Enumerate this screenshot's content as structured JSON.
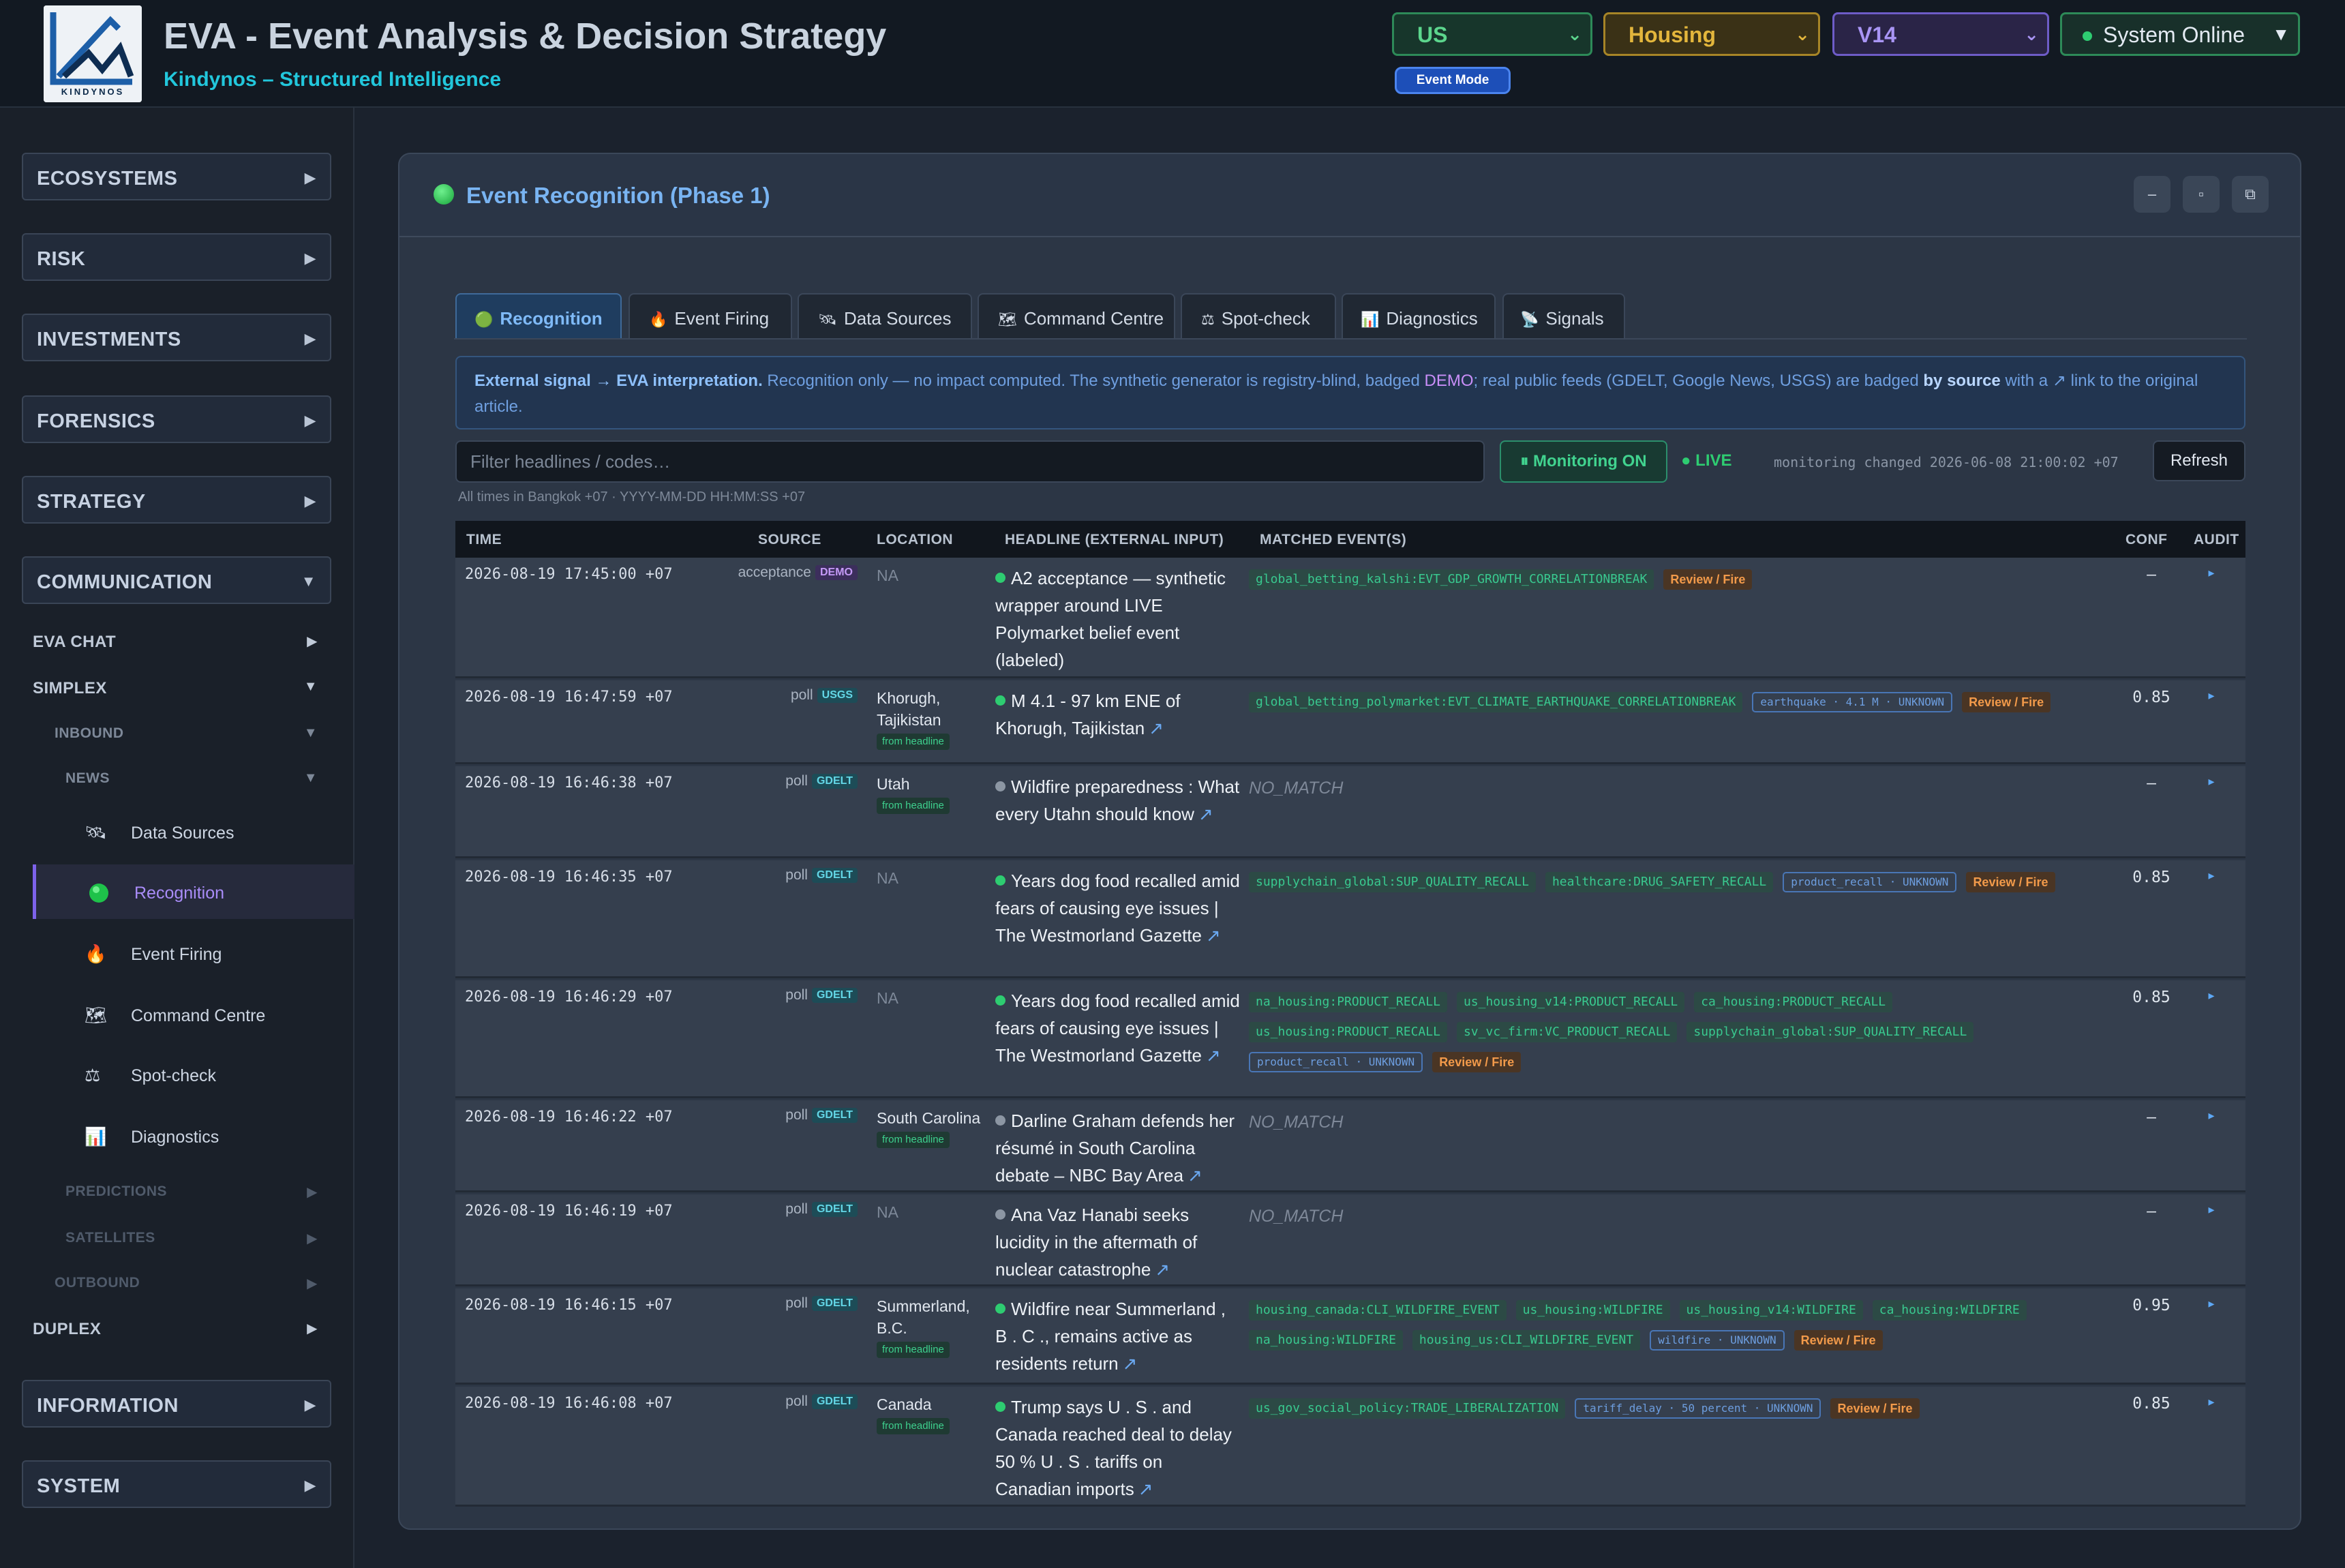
{
  "header": {
    "logo_text": "KINDYNOS",
    "title": "EVA - Event Analysis & Decision Strategy",
    "subtitle": "Kindynos – Structured Intelligence",
    "region": "US",
    "sector": "Housing",
    "version": "V14",
    "status": "System Online",
    "event_mode": "Event Mode"
  },
  "sidebar": {
    "ecosystems": "ECOSYSTEMS",
    "risk": "RISK",
    "investments": "INVESTMENTS",
    "forensics": "FORENSICS",
    "strategy": "STRATEGY",
    "communication": "COMMUNICATION",
    "eva_chat": "EVA CHAT",
    "simplex": "SIMPLEX",
    "inbound": "INBOUND",
    "news": "NEWS",
    "items": [
      {
        "label": "Data Sources",
        "icon": "satellite-icon"
      },
      {
        "label": "Recognition",
        "icon": "green-dot-icon"
      },
      {
        "label": "Event Firing",
        "icon": "fire-icon"
      },
      {
        "label": "Command Centre",
        "icon": "map-icon"
      },
      {
        "label": "Spot-check",
        "icon": "balance-icon"
      },
      {
        "label": "Diagnostics",
        "icon": "chart-icon"
      }
    ],
    "predictions": "PREDICTIONS",
    "satellites": "SATELLITES",
    "outbound": "OUTBOUND",
    "duplex": "DUPLEX",
    "information": "INFORMATION",
    "system": "SYSTEM"
  },
  "panel": {
    "title": "Event Recognition (Phase 1)",
    "tabs": [
      {
        "label": "Recognition",
        "icon": "green-dot-icon"
      },
      {
        "label": "Event Firing",
        "icon": "fire-icon"
      },
      {
        "label": "Data Sources",
        "icon": "satellite-icon"
      },
      {
        "label": "Command Centre",
        "icon": "map-icon"
      },
      {
        "label": "Spot-check",
        "icon": "balance-icon"
      },
      {
        "label": "Diagnostics",
        "icon": "chart-icon"
      },
      {
        "label": "Signals",
        "icon": "antenna-icon"
      }
    ],
    "info": {
      "lead": "External signal → EVA interpretation.",
      "part1": " Recognition only — no impact computed. The synthetic generator is registry-blind, badged ",
      "demo": "DEMO",
      "part2": "; real public feeds (GDELT, Google News, USGS) are badged ",
      "by_source": "by source",
      "part3": " with a ↗ link to the original article."
    },
    "filter_placeholder": "Filter headlines / codes…",
    "monitoring": "⏸ Monitoring ON",
    "live": "● LIVE",
    "monitoring_changed": "monitoring changed 2026-06-08 21:00:02 +07",
    "refresh": "Refresh",
    "tz_note": "All times in Bangkok +07 · YYYY-MM-DD HH:MM:SS +07",
    "columns": {
      "time": "TIME",
      "source": "SOURCE",
      "location": "LOCATION",
      "headline": "HEADLINE (EXTERNAL INPUT)",
      "matched": "MATCHED EVENT(S)",
      "conf": "CONF",
      "audit": "AUDIT"
    }
  },
  "rows": [
    {
      "time": "2026-08-19 17:45:00 +07",
      "source": "acceptance",
      "badge": "DEMO",
      "location": "NA",
      "from_headline": "",
      "headline": "A2 acceptance — synthetic wrapper around LIVE Polymarket belief event (labeled)",
      "dot": "green",
      "link": false,
      "matches": [
        "global_betting_kalshi:EVT_GDP_GROWTH_CORRELATIONBREAK"
      ],
      "hints": [],
      "review": "Review / Fire",
      "no_match": "",
      "conf": "—",
      "audit": "▸"
    },
    {
      "time": "2026-08-19 16:47:59 +07",
      "source": "poll",
      "badge": "USGS",
      "location": "Khorugh, Tajikistan",
      "from_headline": "from headline",
      "headline": "M 4.1 - 97 km ENE of Khorugh, Tajikistan",
      "dot": "green",
      "link": true,
      "matches": [
        "global_betting_polymarket:EVT_CLIMATE_EARTHQUAKE_CORRELATIONBREAK"
      ],
      "hints": [
        "earthquake · 4.1 M · UNKNOWN"
      ],
      "review": "Review / Fire",
      "no_match": "",
      "conf": "0.85",
      "audit": "▸"
    },
    {
      "time": "2026-08-19 16:46:38 +07",
      "source": "poll",
      "badge": "GDELT",
      "location": "Utah",
      "from_headline": "from headline",
      "headline": "Wildfire preparedness : What every Utahn should know",
      "dot": "grey",
      "link": true,
      "matches": [],
      "hints": [],
      "review": "",
      "no_match": "NO_MATCH",
      "conf": "—",
      "audit": "▸"
    },
    {
      "time": "2026-08-19 16:46:35 +07",
      "source": "poll",
      "badge": "GDELT",
      "location": "NA",
      "from_headline": "",
      "headline": "Years dog food recalled amid fears of causing eye issues | The Westmorland Gazette",
      "dot": "green",
      "link": true,
      "matches": [
        "supplychain_global:SUP_QUALITY_RECALL",
        "healthcare:DRUG_SAFETY_RECALL"
      ],
      "hints": [
        "product_recall · UNKNOWN"
      ],
      "review": "Review / Fire",
      "no_match": "",
      "conf": "0.85",
      "audit": "▸"
    },
    {
      "time": "2026-08-19 16:46:29 +07",
      "source": "poll",
      "badge": "GDELT",
      "location": "NA",
      "from_headline": "",
      "headline": "Years dog food recalled amid fears of causing eye issues | The Westmorland Gazette",
      "dot": "green",
      "link": true,
      "matches": [
        "na_housing:PRODUCT_RECALL",
        "us_housing_v14:PRODUCT_RECALL",
        "ca_housing:PRODUCT_RECALL",
        "us_housing:PRODUCT_RECALL",
        "sv_vc_firm:VC_PRODUCT_RECALL",
        "supplychain_global:SUP_QUALITY_RECALL"
      ],
      "hints": [
        "product_recall · UNKNOWN"
      ],
      "review": "Review / Fire",
      "no_match": "",
      "conf": "0.85",
      "audit": "▸"
    },
    {
      "time": "2026-08-19 16:46:22 +07",
      "source": "poll",
      "badge": "GDELT",
      "location": "South Carolina",
      "from_headline": "from headline",
      "headline": "Darline Graham defends her résumé in South Carolina debate – NBC Bay Area",
      "dot": "grey",
      "link": true,
      "matches": [],
      "hints": [],
      "review": "",
      "no_match": "NO_MATCH",
      "conf": "—",
      "audit": "▸"
    },
    {
      "time": "2026-08-19 16:46:19 +07",
      "source": "poll",
      "badge": "GDELT",
      "location": "NA",
      "from_headline": "",
      "headline": "Ana Vaz Hanabi seeks lucidity in the aftermath of nuclear catastrophe",
      "dot": "grey",
      "link": true,
      "matches": [],
      "hints": [],
      "review": "",
      "no_match": "NO_MATCH",
      "conf": "—",
      "audit": "▸"
    },
    {
      "time": "2026-08-19 16:46:15 +07",
      "source": "poll",
      "badge": "GDELT",
      "location": "Summerland, B.C.",
      "from_headline": "from headline",
      "headline": "Wildfire near Summerland , B . C ., remains active as residents return",
      "dot": "green",
      "link": true,
      "matches": [
        "housing_canada:CLI_WILDFIRE_EVENT",
        "us_housing:WILDFIRE",
        "us_housing_v14:WILDFIRE",
        "ca_housing:WILDFIRE",
        "na_housing:WILDFIRE",
        "housing_us:CLI_WILDFIRE_EVENT"
      ],
      "hints": [
        "wildfire · UNKNOWN"
      ],
      "review": "Review / Fire",
      "no_match": "",
      "conf": "0.95",
      "audit": "▸"
    },
    {
      "time": "2026-08-19 16:46:08 +07",
      "source": "poll",
      "badge": "GDELT",
      "location": "Canada",
      "from_headline": "from headline",
      "headline": "Trump says U . S . and Canada reached deal to delay 50 % U . S . tariffs on Canadian imports",
      "dot": "green",
      "link": true,
      "matches": [
        "us_gov_social_policy:TRADE_LIBERALIZATION"
      ],
      "hints": [
        "tariff_delay · 50 percent · UNKNOWN"
      ],
      "review": "Review / Fire",
      "no_match": "",
      "conf": "0.85",
      "audit": "▸"
    }
  ]
}
